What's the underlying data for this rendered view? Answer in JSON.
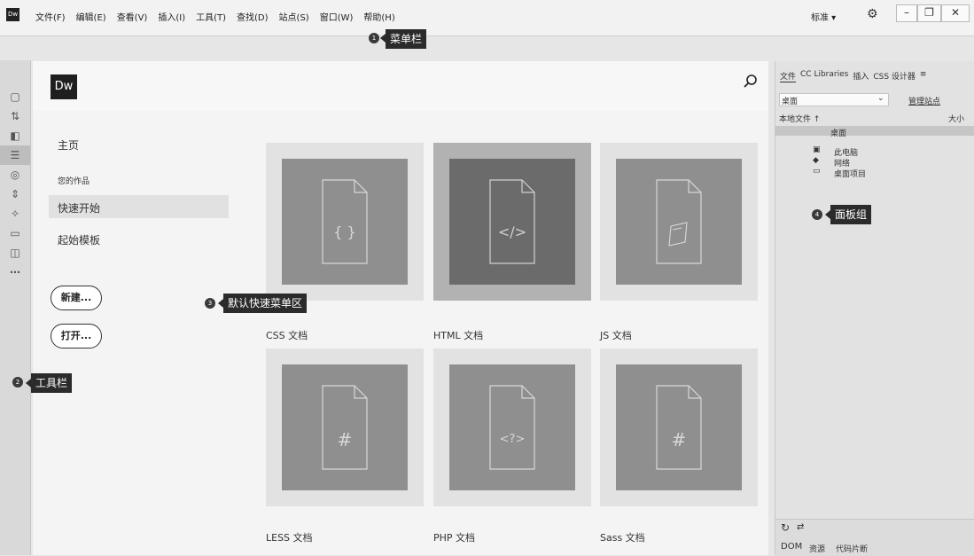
{
  "menubar": {
    "app_icon": "Dw",
    "items": [
      "文件(F)",
      "编辑(E)",
      "查看(V)",
      "插入(I)",
      "工具(T)",
      "查找(D)",
      "站点(S)",
      "窗口(W)",
      "帮助(H)"
    ],
    "workspace": "标准 ▾",
    "gear_icon": "⚙",
    "minimize": "–",
    "restore": "❐",
    "close": "✕"
  },
  "toolbar": {
    "icons": [
      "document-icon",
      "sort-icon",
      "inspect-icon",
      "list-icon",
      "target-icon",
      "expand-icon",
      "transform-icon",
      "comment-icon",
      "snippet-icon",
      "more-icon"
    ]
  },
  "start": {
    "logo": "Dw",
    "nav": {
      "home": "主页",
      "your_work": "您的作品",
      "quick_start": "快速开始",
      "templates": "起始模板"
    },
    "new_button": "新建...",
    "open_button": "打开...",
    "tiles": [
      {
        "label": "CSS 文档",
        "glyph": "{ }"
      },
      {
        "label": "HTML 文档",
        "glyph": "</>"
      },
      {
        "label": "JS 文档",
        "glyph": ""
      },
      {
        "label": "LESS 文档",
        "glyph": "#"
      },
      {
        "label": "PHP 文档",
        "glyph": "<?>"
      },
      {
        "label": "Sass 文档",
        "glyph": "#"
      }
    ]
  },
  "panel": {
    "tabs": [
      "文件",
      "CC Libraries",
      "插入",
      "CSS 设计器",
      "≡"
    ],
    "site": "桌面",
    "manage_sites": "管理站点",
    "local_files": "本地文件 ↑",
    "size": "大小",
    "tree": [
      "桌面",
      "此电脑",
      "网络",
      "桌面项目"
    ],
    "footer_tabs": [
      "DOM",
      "资源",
      "代码片断"
    ]
  },
  "callouts": [
    {
      "num": "1",
      "label": "菜单栏"
    },
    {
      "num": "2",
      "label": "工具栏"
    },
    {
      "num": "3",
      "label": "默认快速菜单区"
    },
    {
      "num": "4",
      "label": "面板组"
    }
  ]
}
